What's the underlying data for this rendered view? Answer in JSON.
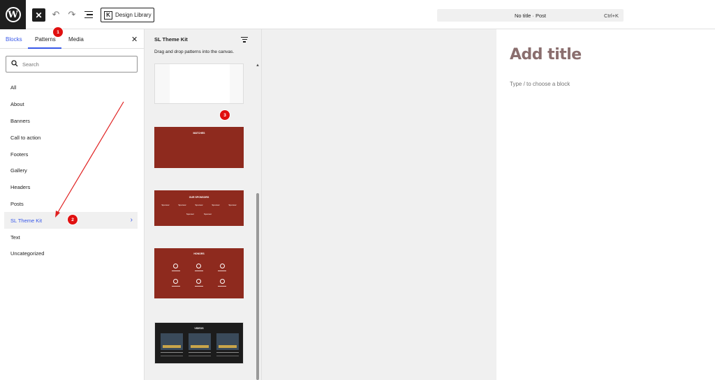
{
  "topbar": {
    "logo": "W",
    "close_glyph": "✕",
    "undo_glyph": "↶",
    "redo_glyph": "↷",
    "design_library_label": "Design Library",
    "design_library_icon_letter": "K",
    "document_title": "No title · Post",
    "command_shortcut": "Ctrl+K"
  },
  "sidebar": {
    "tabs": [
      {
        "label": "Blocks"
      },
      {
        "label": "Patterns"
      },
      {
        "label": "Media"
      }
    ],
    "close_glyph": "✕",
    "search_placeholder": "Search",
    "categories": [
      {
        "label": "All"
      },
      {
        "label": "About"
      },
      {
        "label": "Banners"
      },
      {
        "label": "Call to action"
      },
      {
        "label": "Footers"
      },
      {
        "label": "Gallery"
      },
      {
        "label": "Headers"
      },
      {
        "label": "Posts"
      },
      {
        "label": "SL Theme Kit",
        "active": true
      },
      {
        "label": "Text"
      },
      {
        "label": "Uncategorized"
      }
    ]
  },
  "patterns_panel": {
    "title": "SL Theme Kit",
    "description": "Drag and drop patterns into the canvas.",
    "cards": [
      {
        "label": ""
      },
      {
        "label": "MATCHES"
      },
      {
        "label": "OUR SPONSORS",
        "sponsor_word": "Sponsor"
      },
      {
        "label": "HONORS"
      },
      {
        "label": "VIDEOS"
      }
    ]
  },
  "canvas": {
    "title_placeholder": "Add title",
    "block_hint": "Type / to choose a block"
  },
  "annotations": {
    "badge_1": "1",
    "badge_2": "2",
    "badge_3": "3",
    "badge_color": "#e01010",
    "arrow_color": "#e02020"
  },
  "colors": {
    "accent": "#3858e9",
    "pattern_red": "#8e2a1e",
    "title_color": "#8a6e6e"
  }
}
